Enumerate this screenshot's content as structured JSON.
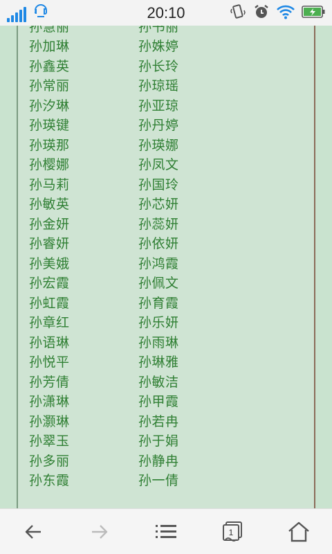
{
  "status_bar": {
    "time": "20:10",
    "icons": [
      "signal-icon",
      "chat-bubble-icon",
      "vibrate-icon",
      "alarm-icon",
      "wifi-icon",
      "battery-charging-icon"
    ]
  },
  "names": [
    [
      "孙慧丽",
      "孙书丽"
    ],
    [
      "孙加琳",
      "孙姝婷"
    ],
    [
      "孙鑫英",
      "孙长玲"
    ],
    [
      "孙常丽",
      "孙琼瑶"
    ],
    [
      "孙汐琳",
      "孙亚琼"
    ],
    [
      "孙瑛键",
      "孙丹婷"
    ],
    [
      "孙瑛那",
      "孙瑛娜"
    ],
    [
      "孙樱娜",
      "孙凤文"
    ],
    [
      "孙马莉",
      "孙国玲"
    ],
    [
      "孙敏英",
      "孙芯妍"
    ],
    [
      "孙金妍",
      "孙蕊妍"
    ],
    [
      "孙睿妍",
      "孙依妍"
    ],
    [
      "孙美娥",
      "孙鸿霞"
    ],
    [
      "孙宏霞",
      "孙佩文"
    ],
    [
      "孙虹霞",
      "孙育霞"
    ],
    [
      "孙章红",
      "孙乐妍"
    ],
    [
      "孙语琳",
      "孙雨琳"
    ],
    [
      "孙悦平",
      "孙琳雅"
    ],
    [
      "孙芳倩",
      "孙敏洁"
    ],
    [
      "孙潇琳",
      "孙甲霞"
    ],
    [
      "孙灏琳",
      "孙若冉"
    ],
    [
      "孙翠玉",
      "孙于娟"
    ],
    [
      "孙多丽",
      "孙静冉"
    ],
    [
      "孙东霞",
      "孙一倩"
    ]
  ],
  "bottom_nav": {
    "tab_count": "1",
    "icons": [
      "back-arrow-icon",
      "forward-arrow-icon",
      "menu-list-icon",
      "tabs-icon",
      "home-icon"
    ]
  },
  "colors": {
    "name_text": "#2f7f33",
    "background": "#cfe4d3",
    "status_blue": "#1e88e5",
    "battery_green": "#4caf50"
  }
}
